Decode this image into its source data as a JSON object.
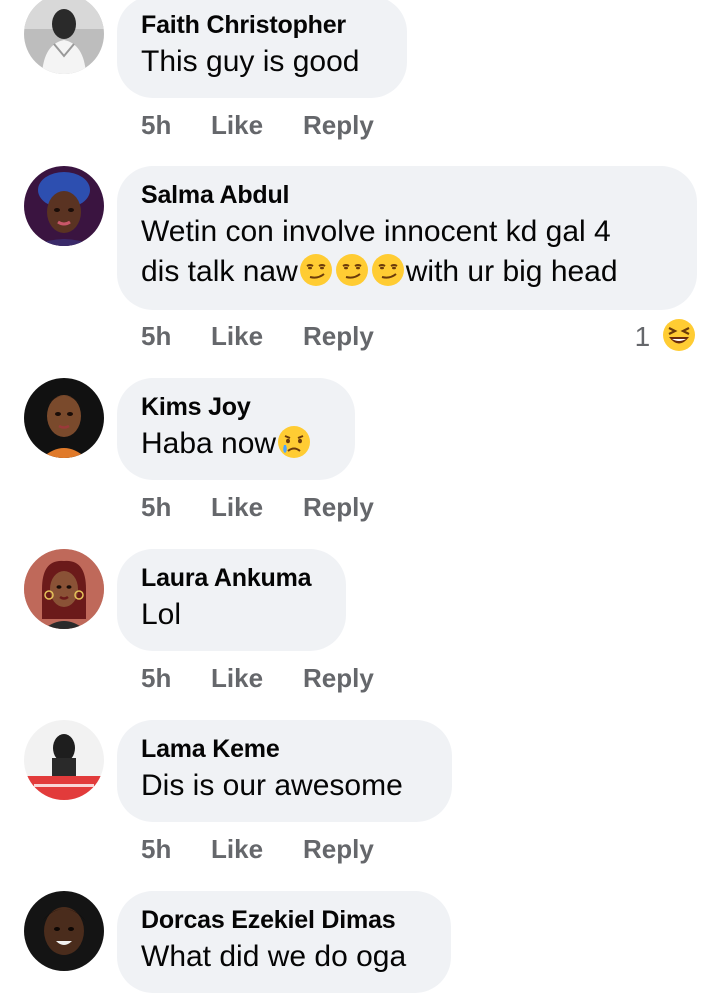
{
  "comments": [
    {
      "name": "Faith Christopher",
      "text_parts": [
        "This guy is good"
      ],
      "time": "5h",
      "like_label": "Like",
      "reply_label": "Reply",
      "avatar_icon": "profile-photo"
    },
    {
      "name": "Salma Abdul",
      "line1": "Wetin con involve innocent kd gal 4",
      "line2_a": "dis talk naw",
      "line2_emojis": [
        "smirking-face",
        "smirking-face",
        "smirking-face"
      ],
      "line2_b": "with ur big head",
      "time": "5h",
      "like_label": "Like",
      "reply_label": "Reply",
      "reaction_count": "1",
      "reaction_icon": "laughing-face",
      "avatar_icon": "profile-photo"
    },
    {
      "name": "Kims Joy",
      "text_a": "Haba now",
      "emoji": "sad-but-relieved-face",
      "time": "5h",
      "like_label": "Like",
      "reply_label": "Reply",
      "avatar_icon": "profile-photo"
    },
    {
      "name": "Laura Ankuma",
      "text": "Lol",
      "time": "5h",
      "like_label": "Like",
      "reply_label": "Reply",
      "avatar_icon": "profile-photo"
    },
    {
      "name": "Lama Keme",
      "text": "Dis is our awesome",
      "time": "5h",
      "like_label": "Like",
      "reply_label": "Reply",
      "avatar_icon": "profile-photo"
    },
    {
      "name": "Dorcas Ezekiel Dimas",
      "text": "What did we do oga",
      "avatar_icon": "profile-photo"
    }
  ],
  "colors": {
    "bubble": "#f0f2f5",
    "name": "#050505",
    "meta": "#65676b"
  }
}
